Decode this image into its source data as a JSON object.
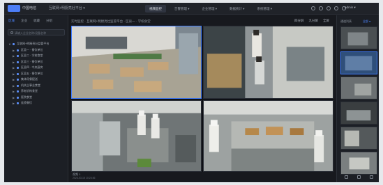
{
  "topbar": {
    "logo_text": "中国电信",
    "app_title": "互联网+明厨亮灶平台 ▾",
    "nav": [
      {
        "label": "视频监控",
        "active": true
      },
      {
        "label": "告警管理 ▾",
        "active": false
      },
      {
        "label": "企业管理 ▾",
        "active": false
      },
      {
        "label": "数据统计 ▾",
        "active": false
      },
      {
        "label": "系统管理 ▾",
        "active": false
      }
    ],
    "user": "admin ▾"
  },
  "sidebar": {
    "tabs": [
      {
        "label": "区域",
        "active": true
      },
      {
        "label": "企业",
        "active": false
      },
      {
        "label": "收藏",
        "active": false
      },
      {
        "label": "分组",
        "active": false
      }
    ],
    "search_placeholder": "请输入企业名称/设备名称",
    "tree": [
      {
        "label": "互联网+明厨亮灶监管平台",
        "level": 0
      },
      {
        "label": "区县一 · 餐饮单位",
        "level": 1
      },
      {
        "label": "区县二 · 学校食堂",
        "level": 1
      },
      {
        "label": "区县三 · 餐饮单位",
        "level": 1
      },
      {
        "label": "区县四 · 中央厨房",
        "level": 1
      },
      {
        "label": "区县五 · 餐饮单位",
        "level": 1
      },
      {
        "label": "集体用餐配送",
        "level": 1
      },
      {
        "label": "机关企事业食堂",
        "level": 1
      },
      {
        "label": "养老机构食堂",
        "level": 1
      },
      {
        "label": "医院食堂",
        "level": 1
      },
      {
        "label": "连锁餐饮",
        "level": 1
      }
    ]
  },
  "main": {
    "breadcrumb": "实时监控 · 互联网+明厨亮灶监管平台 · 区县一 · 学校食堂",
    "tools": [
      "四分屏",
      "九分屏",
      "全屏"
    ],
    "caption": "视频 1",
    "caption_time": "2023-03-15 10:24:36"
  },
  "right_panel": {
    "title": "通道列表",
    "link": "全部 ▾"
  }
}
